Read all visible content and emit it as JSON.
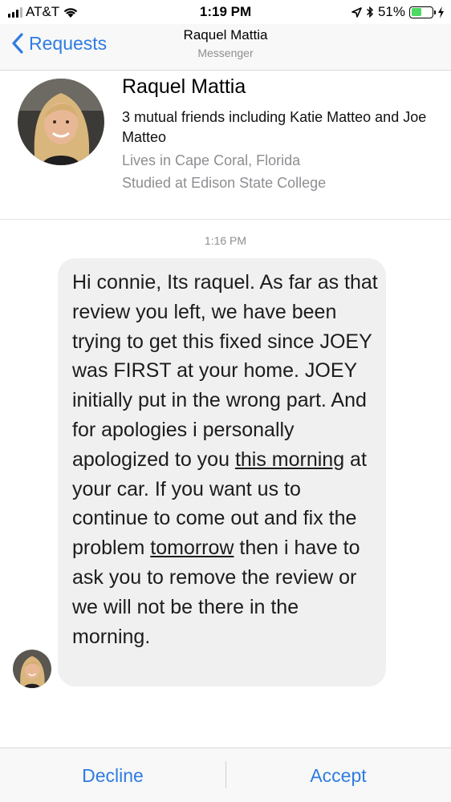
{
  "status_bar": {
    "carrier": "AT&T",
    "time": "1:19 PM",
    "battery_percent": "51%",
    "battery_level": 0.51,
    "icons": [
      "signal-icon",
      "wifi-icon",
      "location-icon",
      "bluetooth-icon",
      "battery-icon",
      "charging-icon"
    ]
  },
  "nav": {
    "back_label": "Requests",
    "title": "Raquel Mattia",
    "subtitle": "Messenger",
    "accent_color": "#2f7ce0"
  },
  "profile": {
    "name": "Raquel Mattia",
    "mutual_friends": "3 mutual friends including Katie Matteo and Joe Matteo",
    "lives_in": "Lives in Cape Coral, Florida",
    "studied_at": "Studied at Edison State College"
  },
  "conversation": {
    "timestamp": "1:16 PM",
    "message": {
      "part1": "Hi connie, Its raquel. As far as that review you left, we have been trying to get this fixed since JOEY was FIRST at your home. JOEY initially put in the wrong part. And for apologies i personally apologized to you ",
      "underline1": "this morning",
      "part2": " at your car. If you want us to continue to come out and fix the problem ",
      "underline2": "tomorrow",
      "part3": " then i have to ask you to remove the review or we will not be there in the morning."
    }
  },
  "actions": {
    "decline_label": "Decline",
    "accept_label": "Accept"
  }
}
